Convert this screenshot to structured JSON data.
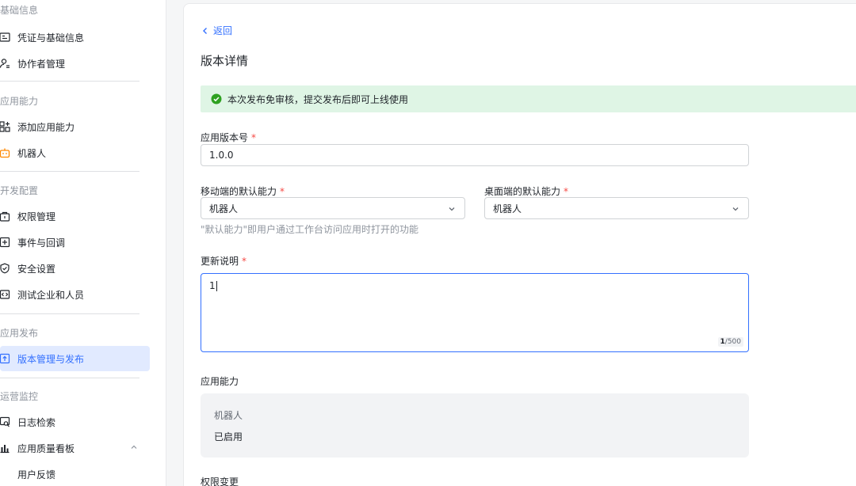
{
  "sidebar": {
    "groups": [
      {
        "title": "基础信息"
      },
      {
        "title": "应用能力"
      },
      {
        "title": "开发配置"
      },
      {
        "title": "应用发布"
      },
      {
        "title": "运营监控"
      }
    ],
    "items": [
      {
        "label": "凭证与基础信息",
        "icon": "id-card-icon"
      },
      {
        "label": "协作者管理",
        "icon": "user-manage-icon"
      },
      {
        "label": "添加应用能力",
        "icon": "grid-add-icon"
      },
      {
        "label": "机器人",
        "icon": "robot-icon"
      },
      {
        "label": "权限管理",
        "icon": "lock-icon"
      },
      {
        "label": "事件与回调",
        "icon": "event-icon"
      },
      {
        "label": "安全设置",
        "icon": "shield-icon"
      },
      {
        "label": "测试企业和人员",
        "icon": "code-icon"
      },
      {
        "label": "版本管理与发布",
        "icon": "upload-icon",
        "active": true
      },
      {
        "label": "日志检索",
        "icon": "log-search-icon"
      },
      {
        "label": "应用质量看板",
        "icon": "bar-chart-icon"
      },
      {
        "label": "用户反馈"
      }
    ]
  },
  "main": {
    "back_label": "返回",
    "page_title": "版本详情",
    "notice": "本次发布免审核，提交发布后即可上线使用",
    "version": {
      "label": "应用版本号",
      "required": "*",
      "value": "1.0.0"
    },
    "mobile_default": {
      "label": "移动端的默认能力",
      "required": "*",
      "value": "机器人"
    },
    "desktop_default": {
      "label": "桌面端的默认能力",
      "required": "*",
      "value": "机器人"
    },
    "default_hint": "\"默认能力\"即用户通过工作台访问应用时打开的功能",
    "release_notes": {
      "label": "更新说明",
      "required": "*",
      "value": "1",
      "count": "1",
      "max": "/500"
    },
    "capabilities": {
      "label": "应用能力",
      "name": "机器人",
      "status": "已启用"
    },
    "permissions_label": "权限变更"
  },
  "colors": {
    "accent": "#3370ff",
    "success": "#2ea121",
    "required": "#f54a45",
    "active_bg": "#e1eaff",
    "robot": "#ff8800"
  }
}
